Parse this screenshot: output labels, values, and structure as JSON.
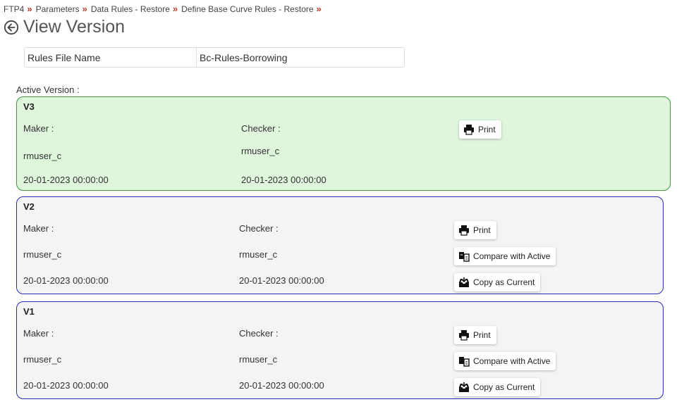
{
  "breadcrumb": {
    "items": [
      "FTP4",
      "Parameters",
      "Data Rules - Restore",
      "Define Base Curve Rules - Restore"
    ],
    "separator": "»"
  },
  "page": {
    "title": "View Version"
  },
  "file_info": {
    "label": "Rules File Name",
    "value": "Bc-Rules-Borrowing"
  },
  "active_label": "Active Version :",
  "versions": [
    {
      "name": "V3",
      "maker_label": "Maker :",
      "maker": "rmuser_c",
      "maker_date": "20-01-2023 00:00:00",
      "checker_label": "Checker :",
      "checker": "rmuser_c",
      "checker_date": "20-01-2023 00:00:00",
      "print_label": "Print"
    },
    {
      "name": "V2",
      "maker_label": "Maker :",
      "maker": "rmuser_c",
      "maker_date": "20-01-2023 00:00:00",
      "checker_label": "Checker :",
      "checker": "rmuser_c",
      "checker_date": "20-01-2023 00:00:00",
      "print_label": "Print",
      "compare_label": "Compare with Active",
      "copy_label": "Copy as Current"
    },
    {
      "name": "V1",
      "maker_label": "Maker :",
      "maker": "rmuser_c",
      "maker_date": "20-01-2023 00:00:00",
      "checker_label": "Checker :",
      "checker": "rmuser_c",
      "checker_date": "20-01-2023 00:00:00",
      "print_label": "Print",
      "compare_label": "Compare with Active",
      "copy_label": "Copy as Current"
    }
  ],
  "colors": {
    "active_bg": "#dff5dc",
    "active_border": "#3c9a3c",
    "other_border": "#2a2ab5",
    "separator": "#c0392b"
  },
  "icons": {
    "back": "arrow-left-circle-icon",
    "print": "printer-icon",
    "compare": "compare-icon",
    "copy": "inbox-download-icon"
  }
}
